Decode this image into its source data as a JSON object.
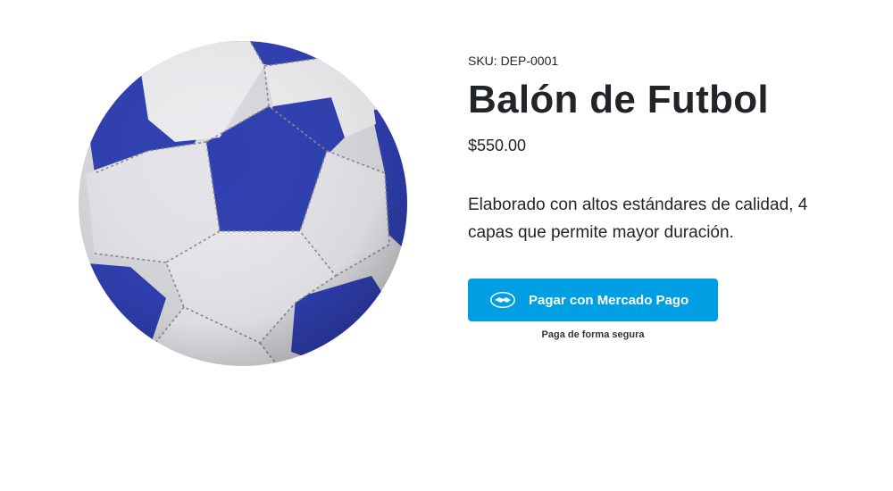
{
  "product": {
    "image_icon": "soccer-ball",
    "sku": "SKU: DEP-0001",
    "title": "Balón de Futbol",
    "price": "$550.00",
    "description": "Elaborado con altos estándares de calidad, 4 capas que permite mayor duración."
  },
  "payment": {
    "button_label": "Pagar con Mercado Pago",
    "button_icon": "handshake-icon",
    "button_color": "#009ee3",
    "secure_note": "Paga de forma segura"
  }
}
